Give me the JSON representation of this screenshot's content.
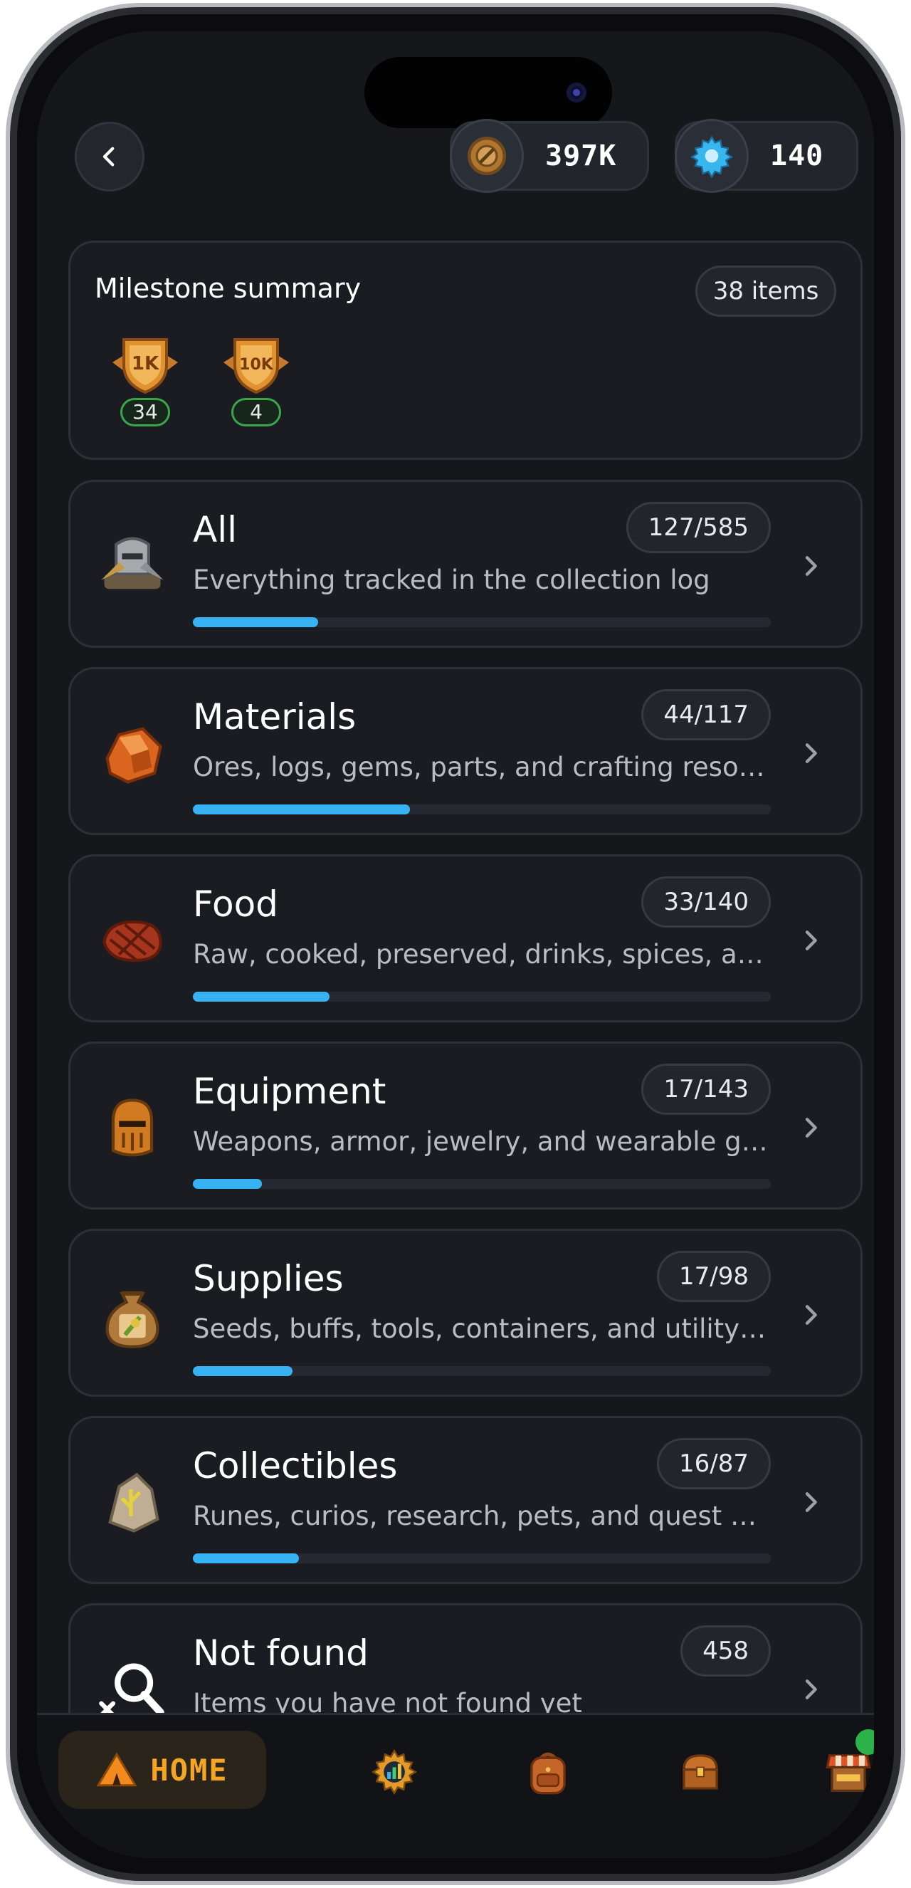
{
  "topbar": {
    "back_icon": "chevron-left-icon",
    "currencies": [
      {
        "icon": "gear-coin-icon",
        "value": "397K"
      },
      {
        "icon": "blue-gear-icon",
        "value": "140"
      }
    ]
  },
  "milestone": {
    "title": "Milestone summary",
    "count_label": "38 items",
    "badges": [
      {
        "label": "1K",
        "count": "34"
      },
      {
        "label": "10K",
        "count": "4"
      }
    ]
  },
  "categories": [
    {
      "title": "All",
      "count": "127/585",
      "description": "Everything tracked in the collection log",
      "progress": 0.217,
      "icon": "armor-pile-icon"
    },
    {
      "title": "Materials",
      "count": "44/117",
      "description": "Ores, logs, gems, parts, and crafting resources",
      "progress": 0.376,
      "icon": "ore-chunk-icon"
    },
    {
      "title": "Food",
      "count": "33/140",
      "description": "Raw, cooked, preserved, drinks, spices, and more",
      "progress": 0.236,
      "icon": "steak-icon"
    },
    {
      "title": "Equipment",
      "count": "17/143",
      "description": "Weapons, armor, jewelry, and wearable gear",
      "progress": 0.119,
      "icon": "helmet-icon"
    },
    {
      "title": "Supplies",
      "count": "17/98",
      "description": "Seeds, buffs, tools, containers, and utility items",
      "progress": 0.173,
      "icon": "seed-sack-icon"
    },
    {
      "title": "Collectibles",
      "count": "16/87",
      "description": "Runes, curios, research, pets, and quest finds",
      "progress": 0.184,
      "icon": "rune-stone-icon"
    },
    {
      "title": "Not found",
      "count": "458",
      "description": "Items you have not found yet",
      "progress": 0,
      "icon": "search-missing-icon"
    }
  ],
  "nav": {
    "home_label": "HOME",
    "items": [
      "home-tent-icon",
      "gear-chart-icon",
      "backpack-icon",
      "treasure-chest-icon",
      "market-stall-icon"
    ]
  },
  "colors": {
    "accent_progress": "#37b3f4",
    "home_accent": "#f5a524",
    "notification": "#2bb34a"
  }
}
